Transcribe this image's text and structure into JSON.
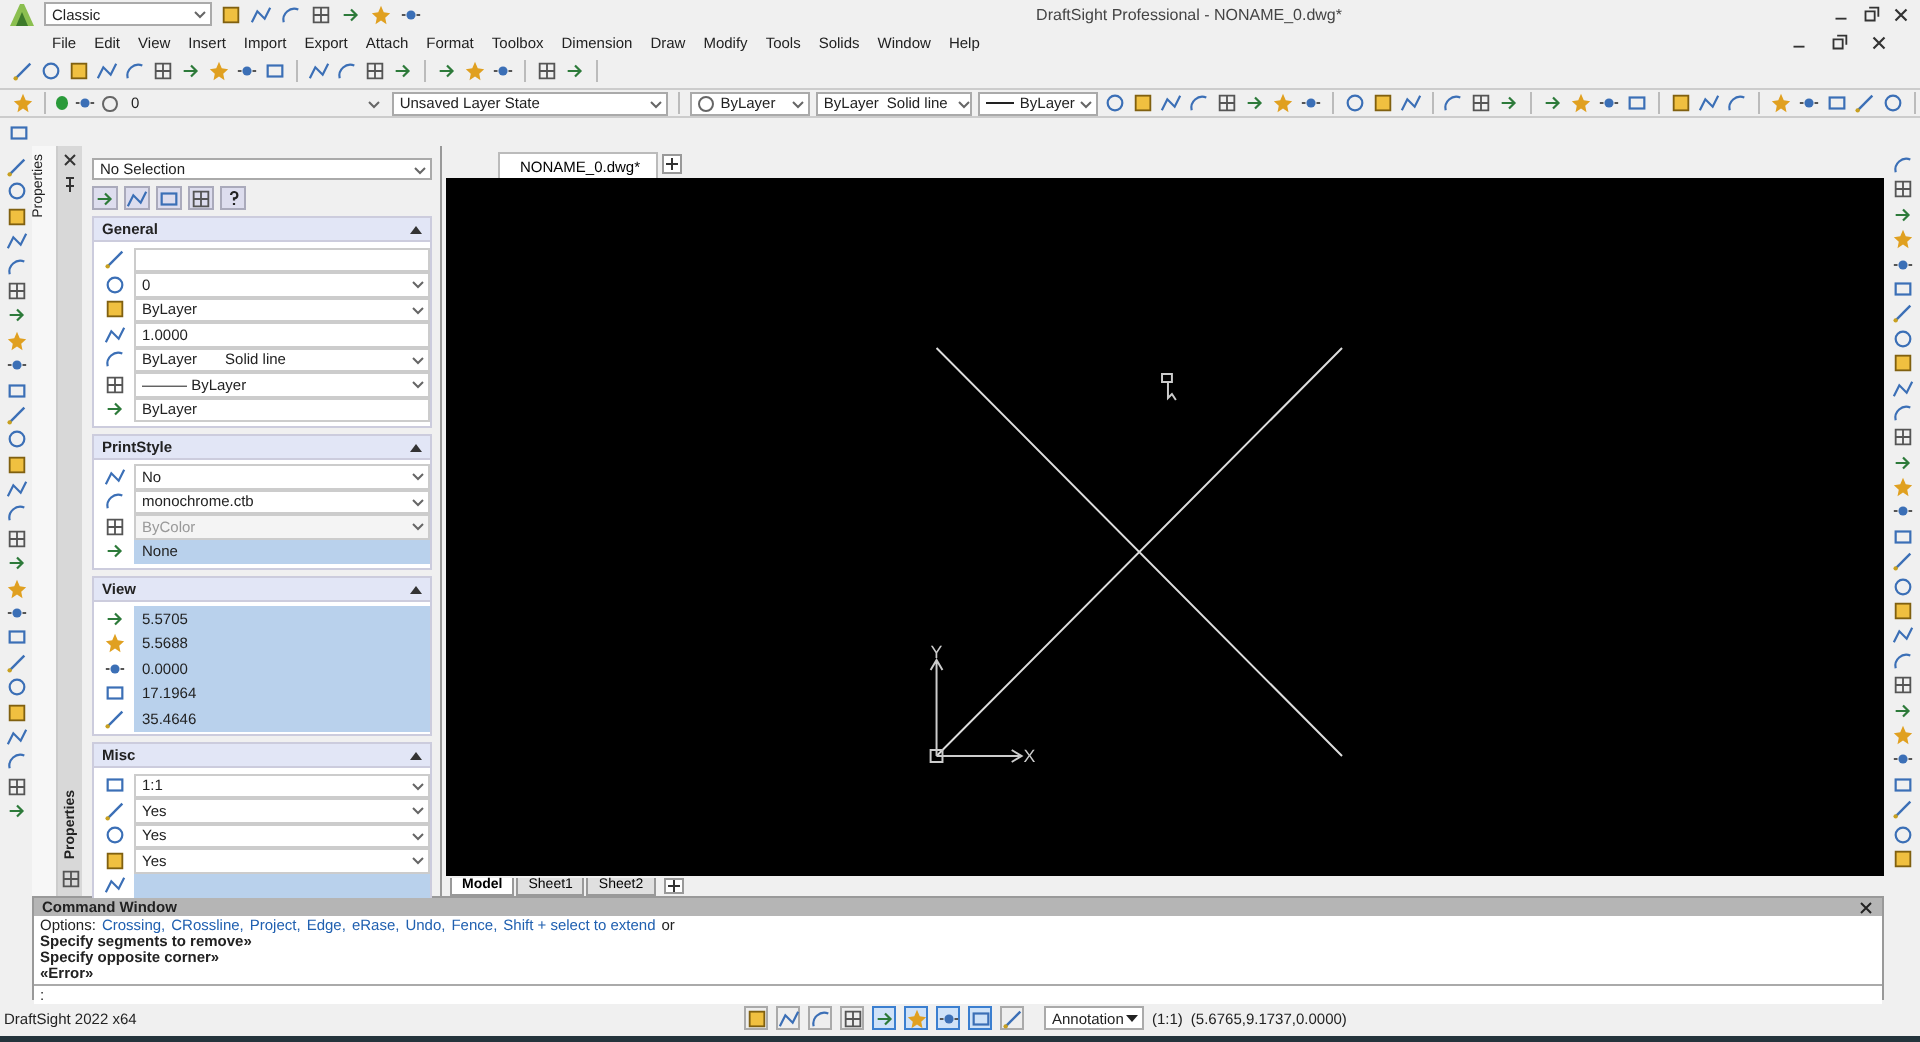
{
  "app": {
    "workspace": "Classic",
    "title": "DraftSight Professional - NONAME_0.dwg*"
  },
  "menu": [
    "File",
    "Edit",
    "View",
    "Insert",
    "Import",
    "Export",
    "Attach",
    "Format",
    "Toolbox",
    "Dimension",
    "Draw",
    "Modify",
    "Tools",
    "Solids",
    "Window",
    "Help"
  ],
  "layer_bar": {
    "layer": "0",
    "layer_state": "Unsaved Layer State",
    "color_name": "ByLayer",
    "linestyle": "ByLayer",
    "linestyle_name": "Solid line",
    "lineweight": "ByLayer"
  },
  "properties": {
    "selection": "No Selection",
    "sections": [
      {
        "title": "General",
        "expanded": true,
        "rows": [
          {
            "kind": "input"
          },
          {
            "kind": "dropdown",
            "value": "0"
          },
          {
            "kind": "dropdown",
            "value": "ByLayer"
          },
          {
            "kind": "input",
            "value": "1.0000"
          },
          {
            "kind": "dropdown",
            "value": "ByLayer",
            "value_2": "Solid line"
          },
          {
            "kind": "dropdown",
            "value": "——— ByLayer"
          },
          {
            "kind": "input",
            "value": "ByLayer"
          }
        ]
      },
      {
        "title": "PrintStyle",
        "expanded": true,
        "rows": [
          {
            "kind": "dropdown",
            "value": "No"
          },
          {
            "kind": "dropdown",
            "value": "monochrome.ctb"
          },
          {
            "kind": "disabled",
            "value": "ByColor"
          },
          {
            "kind": "readonly",
            "value": "None"
          }
        ]
      },
      {
        "title": "View",
        "expanded": true,
        "rows": [
          {
            "kind": "readonly",
            "value": "5.5705"
          },
          {
            "kind": "readonly",
            "value": "5.5688"
          },
          {
            "kind": "readonly",
            "value": "0.0000"
          },
          {
            "kind": "readonly",
            "value": "17.1964"
          },
          {
            "kind": "readonly",
            "value": "35.4646"
          }
        ]
      },
      {
        "title": "Misc",
        "expanded": true,
        "rows": [
          {
            "kind": "dropdown",
            "value": "1:1"
          },
          {
            "kind": "dropdown",
            "value": "Yes"
          },
          {
            "kind": "dropdown",
            "value": "Yes"
          },
          {
            "kind": "dropdown",
            "value": "Yes"
          },
          {
            "kind": "readonly"
          }
        ]
      }
    ]
  },
  "side_tab": "Properties",
  "side_tab_bottom": "Properties",
  "document_tabs": [
    {
      "label": "NONAME_0.dwg*",
      "selected": true
    }
  ],
  "canvas": {
    "y_axis": "Y",
    "x_axis": "X"
  },
  "sheet_tabs": [
    {
      "label": "Model",
      "selected": true
    },
    {
      "label": "Sheet1",
      "selected": false
    },
    {
      "label": "Sheet2",
      "selected": false
    }
  ],
  "command_window": {
    "title": "Command Window",
    "options_label": "Options:",
    "options": [
      "Crossing,",
      "CRossline,",
      "Project,",
      "Edge,",
      "eRase,",
      "Undo,",
      "Fence,",
      "Shift + select to extend"
    ],
    "options_tail": "or",
    "lines": [
      "Specify segments to remove»",
      "Specify opposite corner»",
      "«Error»"
    ],
    "prompt": ":"
  },
  "status_bar": {
    "version": "DraftSight 2022 x64",
    "toggles": [
      {
        "on": false
      },
      {
        "on": false
      },
      {
        "on": false
      },
      {
        "on": false
      },
      {
        "on": true
      },
      {
        "on": true
      },
      {
        "on": true
      },
      {
        "on": true
      },
      {
        "on": false
      }
    ],
    "annotation": "Annotation",
    "scale": "(1:1)",
    "coordinates": "(5.6765,9.1737,0.0000)"
  }
}
